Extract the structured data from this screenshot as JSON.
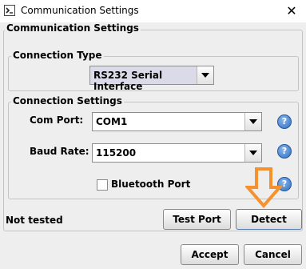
{
  "window": {
    "title": "Communication Settings",
    "close_glyph": "✕"
  },
  "outer_group": {
    "title": "Communication Settings"
  },
  "connection_type": {
    "group_title": "Connection Type",
    "selected": "RS232 Serial Interface"
  },
  "connection_settings": {
    "group_title": "Connection Settings",
    "com_port": {
      "label": "Com Port:",
      "value": "COM1"
    },
    "baud_rate": {
      "label": "Baud Rate:",
      "value": "115200"
    },
    "bluetooth": {
      "label": "Bluetooth Port",
      "checked": false
    },
    "help_glyph": "?"
  },
  "status": {
    "text": "Not tested"
  },
  "buttons": {
    "test_port": "Test Port",
    "detect": "Detect",
    "accept": "Accept",
    "cancel": "Cancel"
  },
  "annotation": {
    "arrow_color": "#f5922e"
  }
}
